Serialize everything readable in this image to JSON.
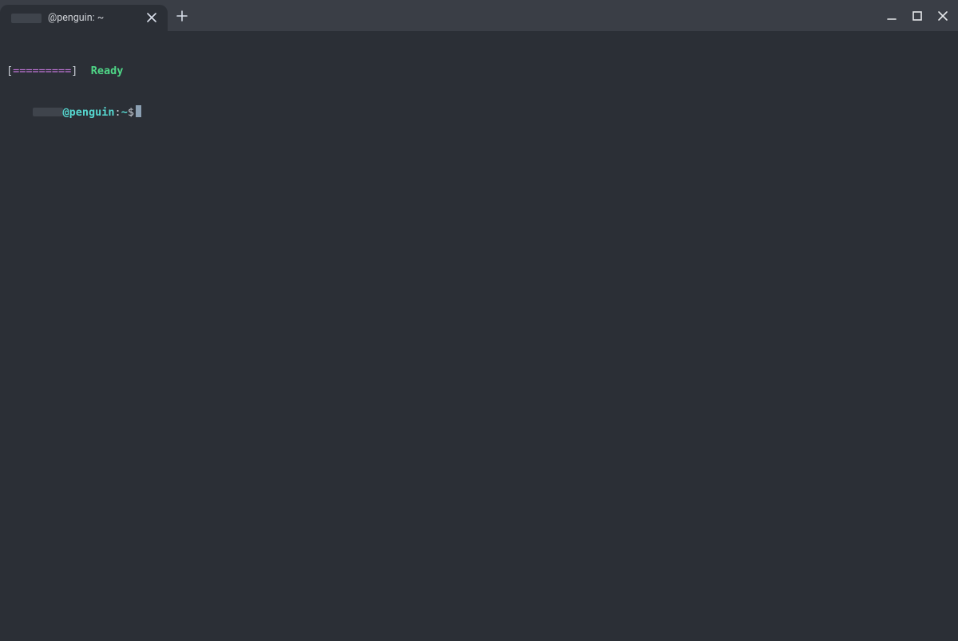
{
  "tab": {
    "title": "@penguin: ~"
  },
  "window_controls": {
    "minimize": "minimize",
    "maximize": "maximize",
    "close": "close"
  },
  "newtab_label": "+",
  "terminal": {
    "line0": {
      "open": "[",
      "bar": "=========",
      "close": "]",
      "status": "Ready"
    },
    "prompt": {
      "userhost": "@penguin",
      "sep": ":",
      "cwd": "~",
      "symbol": "$"
    }
  }
}
